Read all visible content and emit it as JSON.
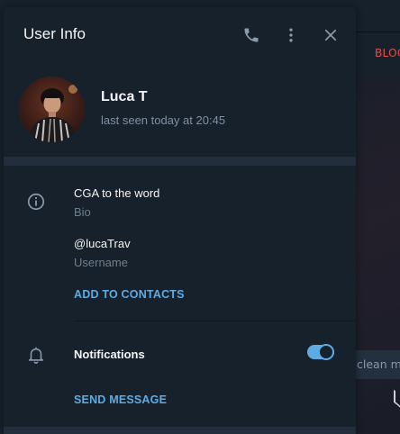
{
  "background": {
    "chat_header_action": "BLOC",
    "message_input_placeholder": "clean me"
  },
  "dialog": {
    "title": "User Info",
    "header_icons": [
      "phone-icon",
      "more-vertical-icon",
      "close-icon"
    ],
    "user": {
      "name": "Luca T",
      "status": "last seen today at 20:45"
    },
    "info": {
      "bio_value": "CGA to the word",
      "bio_label": "Bio",
      "username_value": "@lucaTrav",
      "username_label": "Username",
      "add_contact_label": "ADD TO CONTACTS"
    },
    "notifications": {
      "label": "Notifications",
      "enabled": true
    },
    "send_message_label": "SEND MESSAGE"
  },
  "colors": {
    "panel": "#17212b",
    "accent": "#5eabe3",
    "danger": "#e05050",
    "muted_text": "#7f91a4"
  }
}
